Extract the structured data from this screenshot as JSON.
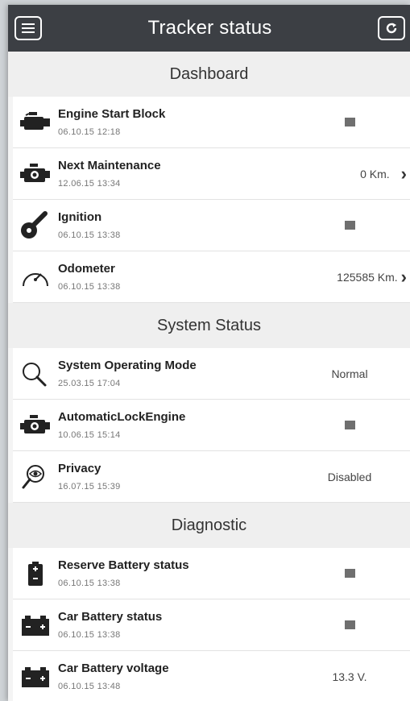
{
  "header": {
    "title": "Tracker status"
  },
  "sections": [
    {
      "title": "Dashboard",
      "rows": [
        {
          "name": "Engine Start Block",
          "date": "06.10.15 12:18",
          "value": ""
        },
        {
          "name": "Next Maintenance",
          "date": "12.06.15 13:34",
          "value": "0 Km."
        },
        {
          "name": "Ignition",
          "date": "06.10.15 13:38",
          "value": ""
        },
        {
          "name": "Odometer",
          "date": "06.10.15 13:38",
          "value": "125585 Km."
        }
      ]
    },
    {
      "title": "System Status",
      "rows": [
        {
          "name": "System Operating Mode",
          "date": "25.03.15 17:04",
          "value": "Normal"
        },
        {
          "name": "AutomaticLockEngine",
          "date": "10.06.15 15:14",
          "value": ""
        },
        {
          "name": "Privacy",
          "date": "16.07.15 15:39",
          "value": "Disabled"
        }
      ]
    },
    {
      "title": "Diagnostic",
      "rows": [
        {
          "name": "Reserve Battery status",
          "date": "06.10.15 13:38",
          "value": ""
        },
        {
          "name": "Car Battery status",
          "date": "06.10.15 13:38",
          "value": ""
        },
        {
          "name": "Car Battery voltage",
          "date": "06.10.15 13:48",
          "value": "13.3 V."
        }
      ]
    }
  ]
}
